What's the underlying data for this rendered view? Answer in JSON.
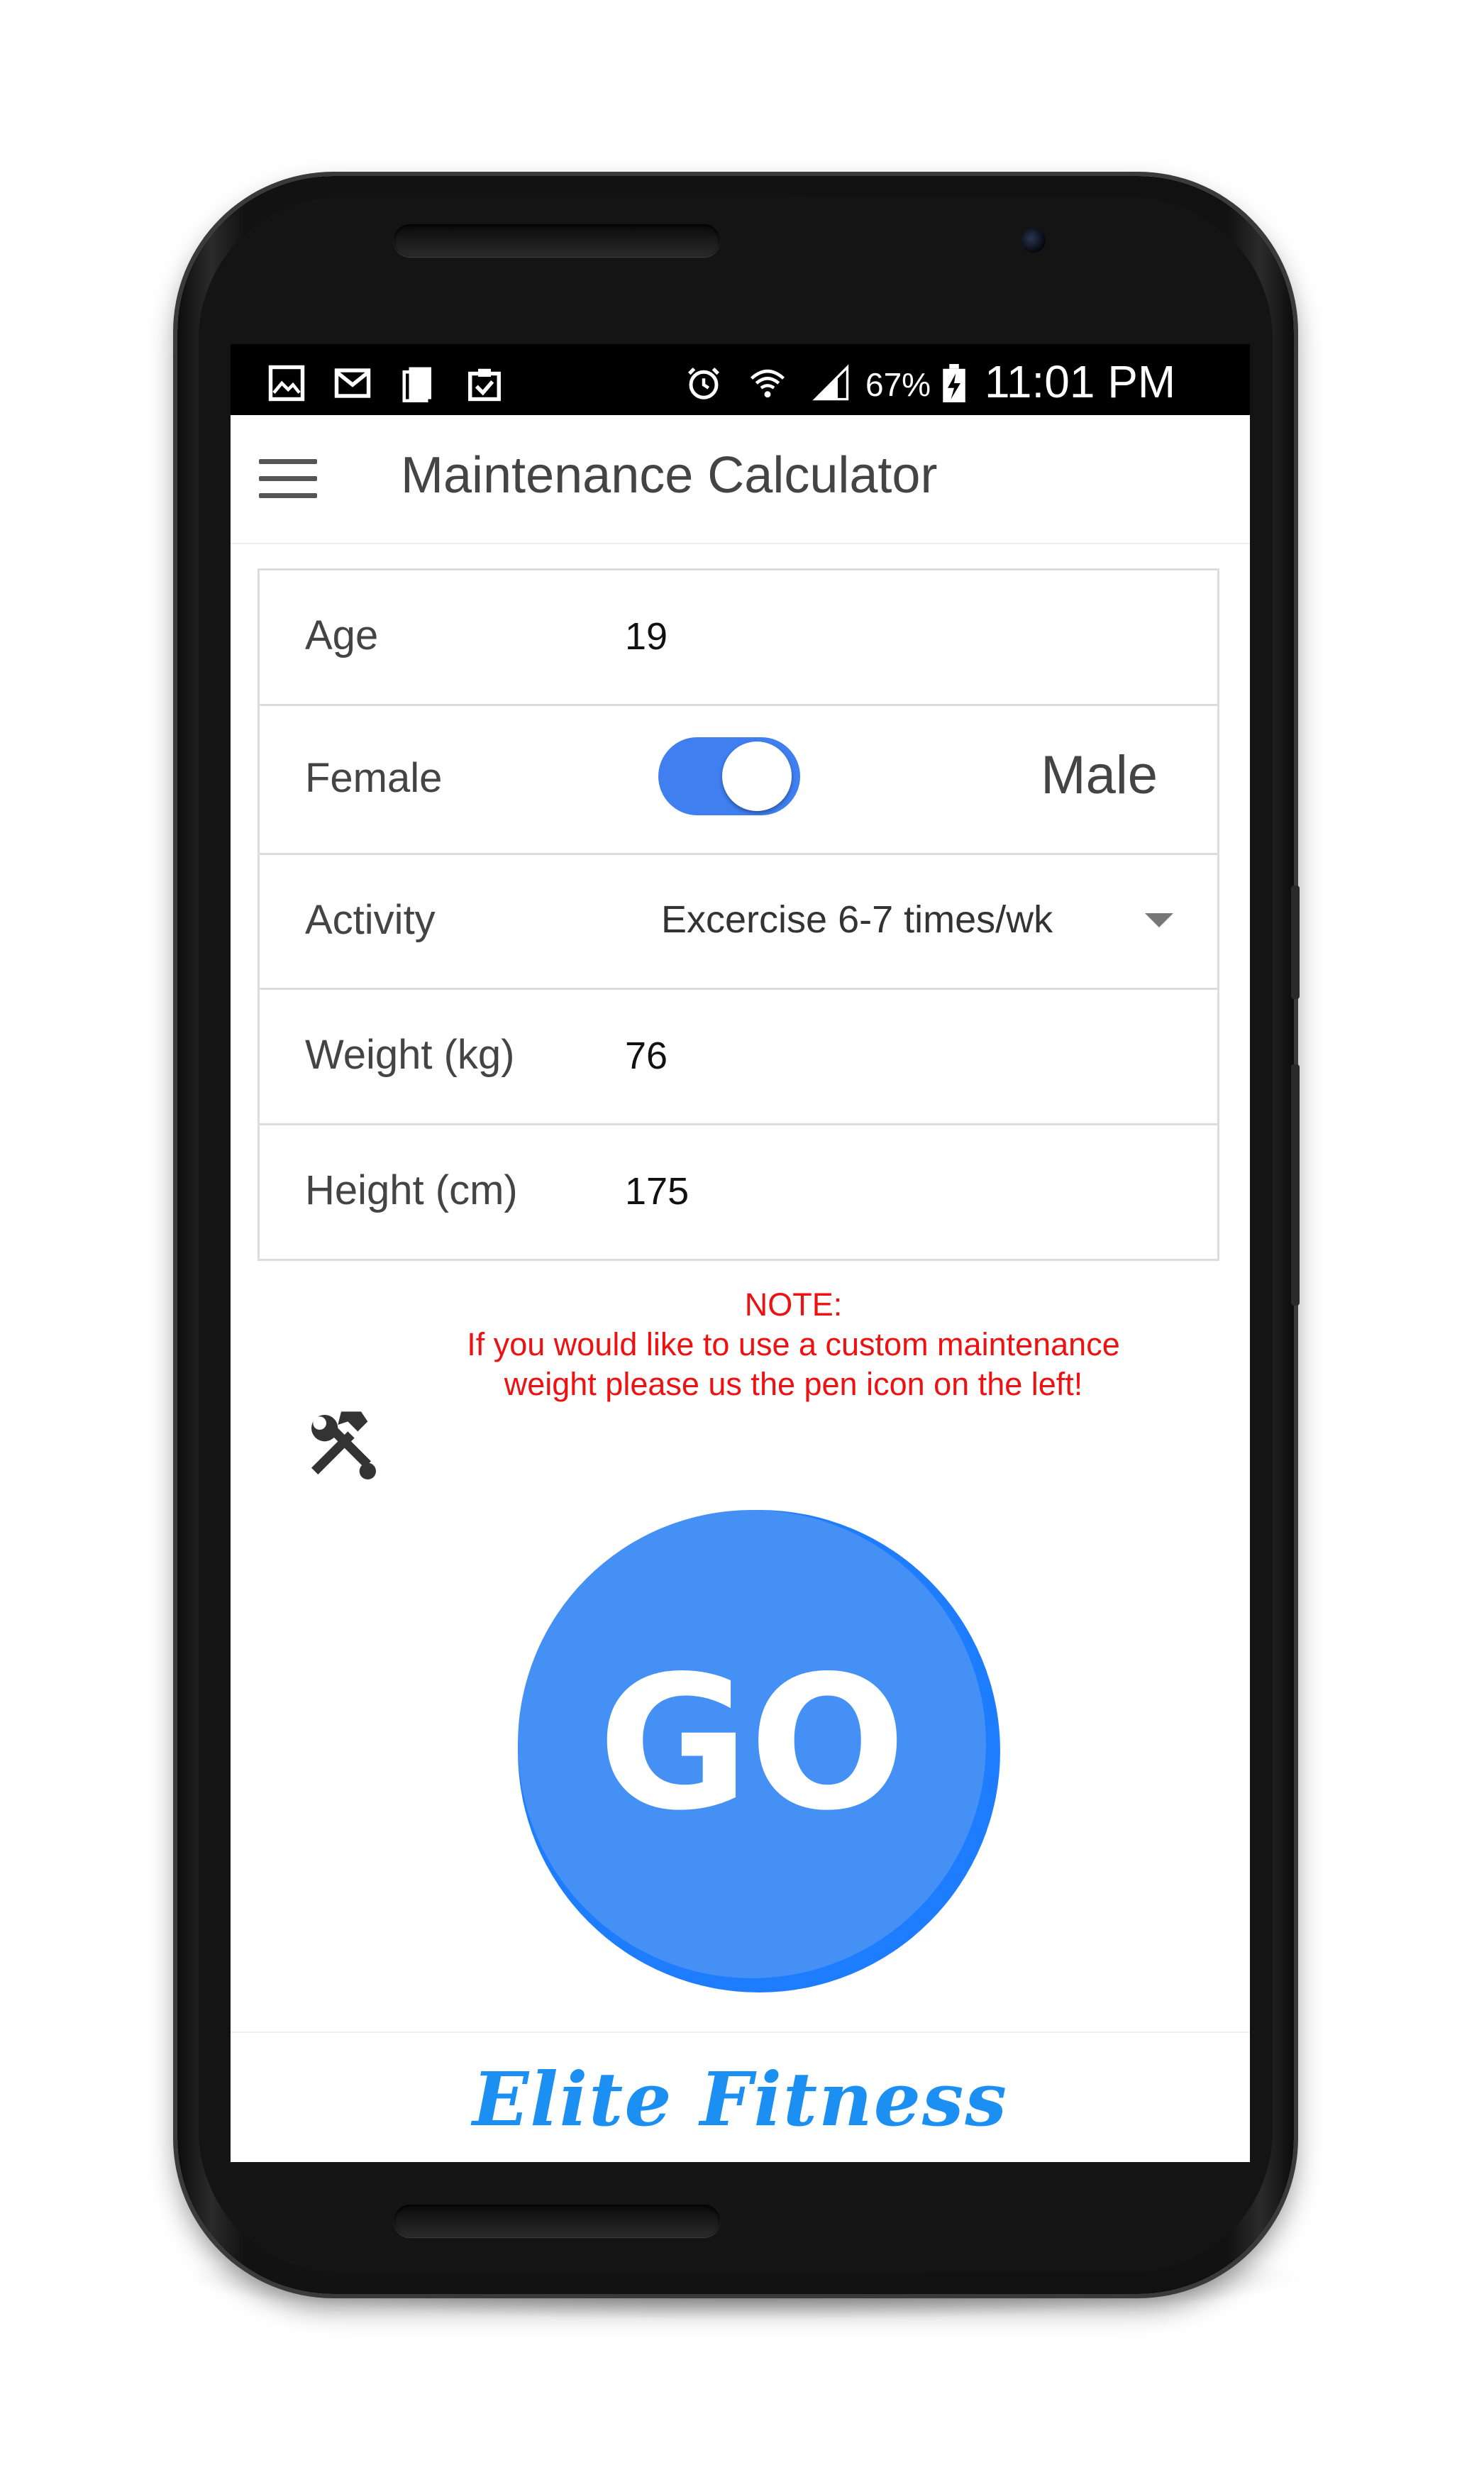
{
  "status_bar": {
    "battery": "67%",
    "time": "11:01 PM",
    "left_icons": [
      "image-icon",
      "gmail-icon",
      "copy-icon",
      "clipboard-check-icon"
    ],
    "right_icons": [
      "alarm-icon",
      "wifi-icon",
      "signal-icon",
      "battery-charging-icon"
    ]
  },
  "app_bar": {
    "title": "Maintenance Calculator",
    "menu_icon": "hamburger-menu-icon"
  },
  "form": {
    "age": {
      "label": "Age",
      "value": "19"
    },
    "gender": {
      "left_label": "Female",
      "right_label": "Male",
      "selected": "Male",
      "toggle_on": true
    },
    "activity": {
      "label": "Activity",
      "value": "Excercise 6-7 times/wk"
    },
    "weight": {
      "label": "Weight (kg)",
      "value": "76"
    },
    "height": {
      "label": "Height (cm)",
      "value": "175"
    }
  },
  "note": {
    "line1": "NOTE:",
    "line2": "If you would like to use a custom maintenance",
    "line3": "weight please us the pen icon on the left!"
  },
  "tools_icon": "hammer-wrench-icon",
  "go_button": {
    "label": "GO"
  },
  "footer": {
    "brand": "Elite Fitness"
  },
  "colors": {
    "accent": "#3f7ff0",
    "go_button": "#4490f5",
    "note_red": "#ee1111",
    "brand_blue": "#1b8ff2"
  }
}
